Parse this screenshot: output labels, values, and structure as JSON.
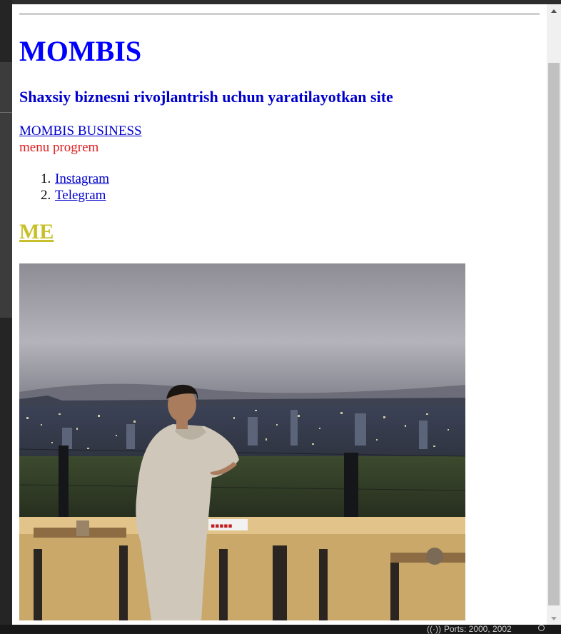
{
  "page": {
    "title": "MOMBIS",
    "subtitle": "Shaxsiy biznesni rivojlantrish uchun yaratilayotkan site",
    "business_link": "MOMBIS BUSINESS",
    "menu_text": "menu progrem",
    "links": [
      {
        "number": "1.",
        "label": "Instagram"
      },
      {
        "number": "2.",
        "label": "Telegram"
      }
    ],
    "me_heading": "ME"
  },
  "status_bar": {
    "ports_label": "Ports: 2000, 2002"
  },
  "colors": {
    "title": "#0000ff",
    "link": "#0000cc",
    "menu_text": "#e02020",
    "me_heading": "#c8c02a"
  },
  "icons": {
    "ports": "broadcast-icon",
    "notifications": "bell-icon"
  }
}
